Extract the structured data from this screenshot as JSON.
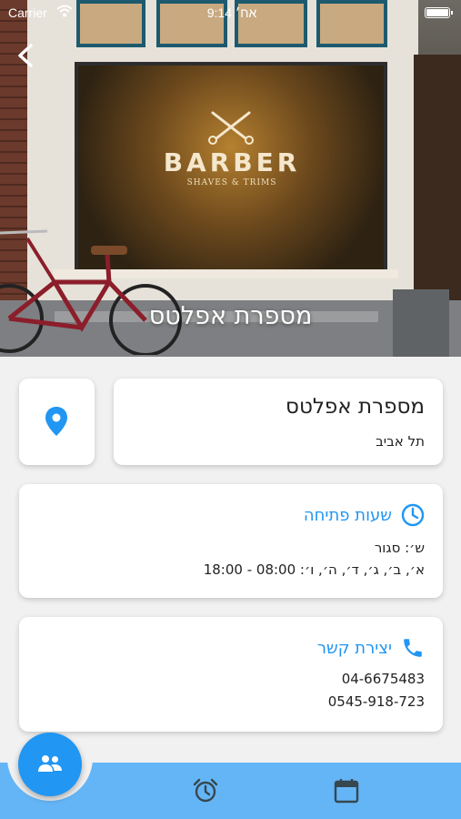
{
  "status_bar": {
    "carrier": "Carrier",
    "time": "9:14 אח׳",
    "battery_level": 1.0
  },
  "hero": {
    "title": "מספרת אפלטס",
    "sign_text": "BARBER",
    "sign_subtitle": "SHAVES & TRIMS",
    "back_icon": "chevron-left-icon"
  },
  "business": {
    "name": "מספרת אפלטס",
    "city": "תל אביב",
    "map_icon": "location-pin-icon"
  },
  "hours": {
    "title": "שעות פתיחה",
    "icon": "clock-icon",
    "lines": [
      "ש׳: סגור",
      "א׳, ב׳, ג׳, ד׳, ה׳, ו׳: 08:00 - 18:00"
    ]
  },
  "contact": {
    "title": "יצירת קשר",
    "icon": "phone-icon",
    "phones": [
      "04-6675483",
      "0545-918-723"
    ]
  },
  "bottom_nav": {
    "fab_icon": "people-icon",
    "items": [
      "alarm-clock-icon",
      "calendar-icon"
    ]
  },
  "colors": {
    "accent": "#2196f3",
    "bottom_bar": "#64b5f6",
    "background": "#f1f1f1",
    "card": "#ffffff"
  }
}
